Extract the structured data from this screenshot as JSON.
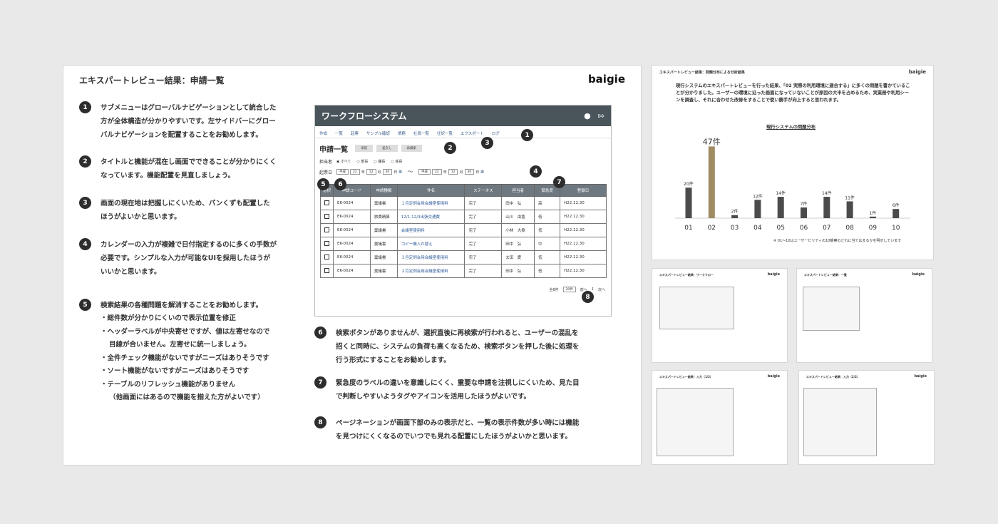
{
  "main": {
    "title": "エキスパートレビュー結果：申請一覧",
    "logo": "baigie",
    "notes_left": [
      {
        "n": "1",
        "text": "サブメニューはグローバルナビゲーションとして統合した\n方が全体構造が分かりやすいです。左サイドバーにグロー\nバルナビゲーションを配置することをお勧めします。"
      },
      {
        "n": "2",
        "text": "タイトルと機能が混在し画面でできることが分かりにくく\nなっています。機能配置を見直しましょう。"
      },
      {
        "n": "3",
        "text": "画面の現在地は把握しにくいため、パンくずも配置した\nほうがよいかと思います。"
      },
      {
        "n": "4",
        "text": "カレンダーの入力が複雑で日付指定するのに多くの手数が\n必要です。シンプルな入力が可能なUIを採用したほうが\nいいかと思います。"
      }
    ],
    "note5": {
      "n": "5",
      "text": "検索結果の各種問題を解消することをお勧めします。",
      "items": [
        "総件数が分かりにくいので表示位置を修正",
        "ヘッダーラベルが中央寄せですが、値は左寄せなので",
        "目線が合いません。左寄せに統一しましょう。",
        "全件チェック機能がないですがニーズはありそうです",
        "ソート機能がないですがニーズはありそうです",
        "テーブルのリフレッシュ機能がありません",
        "（他画面にはあるので機能を揃えた方がよいです）"
      ]
    },
    "notes_right": [
      {
        "n": "6",
        "text": "検索ボタンがありませんが、選択直後に再検索が行われると、ユーザーの混乱を\n招くと同時に、システムの負荷も高くなるため、検索ボタンを押した後に処理を\n行う形式にすることをお勧めします。"
      },
      {
        "n": "7",
        "text": "緊急度のラベルの違いを意識しにくく、重要な申請を注視しにくいため、見た目\nで判断しやすいようタグやアイコンを活用したほうがよいです。"
      },
      {
        "n": "8",
        "text": "ページネーションが画面下部のみの表示だと、一覧の表示件数が多い時には機能\nを見つけにくくなるのでいつでも見れる配置にしたほうがよいかと思います。"
      }
    ]
  },
  "app": {
    "title": "ワークフローシステム",
    "nav": [
      "作成",
      "一覧",
      "起票",
      "サンプル確認",
      "債務",
      "社員一覧",
      "仕訳一覧",
      "エクスポート",
      "ログ"
    ],
    "heading": "申請一覧",
    "buttons": [
      "承認",
      "差戻し",
      "再検索"
    ],
    "assignee_label": "担当者",
    "assignee_options": [
      "すべて",
      "部長",
      "課長",
      "係長"
    ],
    "date_label": "起票日",
    "date_from": {
      "era": "平成",
      "year": "22",
      "month": "12",
      "day": "30"
    },
    "date_to": {
      "era": "平成",
      "year": "22",
      "month": "12",
      "day": "30"
    },
    "unit_year": "年",
    "unit_month": "月",
    "unit_day": "日",
    "tilde": "〜",
    "columns": [
      "選択",
      "申請コード",
      "申請種類",
      "件名",
      "ステータス",
      "担当者",
      "緊急度",
      "登録日"
    ],
    "rows": [
      [
        "EK-0024",
        "稟議書",
        "１月定例会用会議室使用料",
        "完了",
        "田中　弘",
        "高",
        "H22.12.30"
      ],
      [
        "EK-0024",
        "旅費精算",
        "12/1-12/3出張交通費",
        "完了",
        "山川　由香",
        "低",
        "H22.12.30"
      ],
      [
        "EK-0024",
        "稟議書",
        "会議室使用料",
        "完了",
        "小林　大樹",
        "低",
        "H22.12.30"
      ],
      [
        "EK-0024",
        "稟議書",
        "コピー機入れ替え",
        "完了",
        "田中　弘",
        "中",
        "H22.12.30"
      ],
      [
        "EK-0024",
        "稟議書",
        "３月定例会用会議室使用料",
        "完了",
        "太田　愛",
        "低",
        "H22.12.30"
      ],
      [
        "EK-0024",
        "稟議書",
        "２月定例会用会議室使用料",
        "完了",
        "田中　弘",
        "低",
        "H22.12.30"
      ]
    ],
    "pager": {
      "total": "全6件",
      "per_page": "20件",
      "prev": "前へ",
      "page": "1",
      "next": "次へ"
    }
  },
  "markers": [
    "1",
    "2",
    "3",
    "4",
    "5",
    "6",
    "7",
    "8"
  ],
  "summary": {
    "title": "エキスパートレビュー結果：問題分布による分析結果",
    "logo": "baigie",
    "paragraph": "現行システムのエキスパートレビューを行った結果、「02 実際の利用環境に適合する」に多くの問題を書かていることが分かりました。ユーザーの環境に沿った画面になっていないことが原因の大半を占めるため、実業務や利用シーンを調査し、それに合わせた改修をすることで使い勝手が向上すると思われます。",
    "footnote": "※ 01〜10はユーザービリティの10観察のどれに当てはまるかを明示しています",
    "accent": "#a08c62",
    "bar_color": "#4b4b4b"
  },
  "chart_data": {
    "type": "bar",
    "title": "現行システムの問題分布",
    "categories": [
      "01",
      "02",
      "03",
      "04",
      "05",
      "06",
      "07",
      "08",
      "09",
      "10"
    ],
    "values": [
      20,
      47,
      2,
      12,
      14,
      7,
      14,
      11,
      1,
      6
    ],
    "value_labels": [
      "20件",
      "47件",
      "2件",
      "12件",
      "14件",
      "7件",
      "14件",
      "11件",
      "1件",
      "6件"
    ],
    "highlight": "02",
    "ylim": [
      0,
      50
    ]
  },
  "thumbs": [
    {
      "title": "エキスパートレビュー結果：ワークフロー",
      "logo": "baigie"
    },
    {
      "title": "エキスパートレビュー結果：一覧",
      "logo": "baigie"
    },
    {
      "title": "エキスパートレビュー結果：入力（1/2）",
      "logo": "baigie"
    },
    {
      "title": "エキスパートレビュー結果：入力（2/2）",
      "logo": "baigie"
    }
  ]
}
